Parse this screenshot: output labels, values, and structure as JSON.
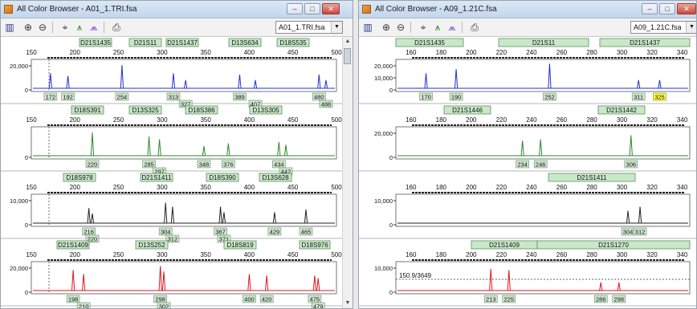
{
  "windows": [
    {
      "id": "A",
      "title": "All Color Browser - A01_1.TRI.fsa",
      "file_select": "A01_1.TRI.fsa",
      "panels": [
        {
          "color": "#1f2fd6",
          "fill": "#1f2fd6",
          "markers": [
            "D21S1435",
            "D21S11",
            "D21S1437",
            "D13S634",
            "D18S535"
          ],
          "ticks": [
            "150",
            "200",
            "250",
            "300",
            "350",
            "400",
            "450",
            "500"
          ],
          "y_labels": [
            "20,000",
            "0"
          ],
          "peaks_top": [
            "172",
            "192",
            "254",
            "313",
            "389",
            "480"
          ],
          "peaks_bottom": [
            "327",
            "407",
            "488"
          ]
        },
        {
          "color": "#2a8a2a",
          "fill": "#2a8a2a",
          "markers": [
            "D18S391",
            "D13S325",
            "D18S386",
            "D13S305"
          ],
          "ticks": [
            "150",
            "200",
            "250",
            "300",
            "350",
            "400",
            "450",
            "500"
          ],
          "y_labels": [
            "0"
          ],
          "peaks_top": [
            "220",
            "285",
            "348",
            "376",
            "434"
          ],
          "peaks_bottom": [
            "297",
            "442"
          ]
        },
        {
          "color": "#222222",
          "fill": "#222222",
          "markers": [
            "D18S978",
            "D21S1411",
            "D18S390",
            "D13S628"
          ],
          "ticks": [
            "150",
            "200",
            "250",
            "300",
            "350",
            "400",
            "450",
            "500"
          ],
          "y_labels": [
            "10,000",
            "0"
          ],
          "peaks_top": [
            "216",
            "304",
            "367",
            "429",
            "465"
          ],
          "peaks_bottom": [
            "220",
            "312",
            "371"
          ]
        },
        {
          "color": "#e0141e",
          "fill": "#e0141e",
          "markers": [
            "D21S1409",
            "D13S252",
            "D18S819",
            "D18S976"
          ],
          "ticks": [
            "150",
            "200",
            "250",
            "300",
            "350",
            "400",
            "450",
            "500"
          ],
          "y_labels": [
            "20,000",
            "0"
          ],
          "peaks_top": [
            "198",
            "298",
            "400",
            "420",
            "475"
          ],
          "peaks_bottom": [
            "210",
            "302",
            "479"
          ]
        }
      ]
    },
    {
      "id": "B",
      "title": "All Color Browser - A09_1.21C.fsa",
      "file_select": "A09_1.21C.fsa",
      "panels": [
        {
          "color": "#1f2fd6",
          "fill": "#1f2fd6",
          "markers": [
            "D21S1435",
            "D21S11",
            "D21S1437"
          ],
          "ticks": [
            "160",
            "180",
            "200",
            "220",
            "240",
            "260",
            "280",
            "300",
            "320",
            "340"
          ],
          "y_labels": [
            "20,000",
            "10,000",
            "0"
          ],
          "peaks_top": [],
          "peaks_bottom": [
            "170",
            "190",
            "252",
            "311",
            "325"
          ],
          "highlight": "325"
        },
        {
          "color": "#2a8a2a",
          "fill": "#2a8a2a",
          "markers": [
            "D21S1446",
            "D21S1442"
          ],
          "ticks": [
            "160",
            "180",
            "200",
            "220",
            "240",
            "260",
            "280",
            "300",
            "320",
            "340"
          ],
          "y_labels": [
            "20,000",
            "0"
          ],
          "peaks_top": [],
          "peaks_bottom": [
            "234",
            "246",
            "306"
          ]
        },
        {
          "color": "#222222",
          "fill": "#222222",
          "markers": [
            "D21S1411"
          ],
          "ticks": [
            "160",
            "180",
            "200",
            "220",
            "240",
            "260",
            "280",
            "300",
            "320",
            "340"
          ],
          "y_labels": [
            "10,000",
            "0"
          ],
          "peaks_top": [],
          "peaks_bottom": [
            "304",
            "312"
          ]
        },
        {
          "color": "#e0141e",
          "fill": "#e0141e",
          "markers": [
            "D21S1409",
            "D21S1270"
          ],
          "ticks": [
            "160",
            "180",
            "200",
            "220",
            "240",
            "260",
            "280",
            "300",
            "320",
            "340"
          ],
          "y_labels": [
            "10,000",
            "0"
          ],
          "cursor_readout": "150.9/3649",
          "peaks_top": [],
          "peaks_bottom": [
            "213",
            "225",
            "286",
            "298"
          ]
        }
      ]
    }
  ],
  "icons": {
    "app": "app-icon",
    "panes": "panes-icon",
    "zoom_in": "zoom-in-icon",
    "zoom_out": "zoom-out-icon",
    "cursor": "cursor-icon",
    "peaks": "peaks-icon",
    "overlay": "overlay-icon",
    "print": "print-icon"
  },
  "colors": {
    "marker_fill": "#c9e8c9",
    "marker_border": "#5f8f5f",
    "label_fill": "#cfe6cf",
    "highlight_fill": "#ffff33"
  }
}
